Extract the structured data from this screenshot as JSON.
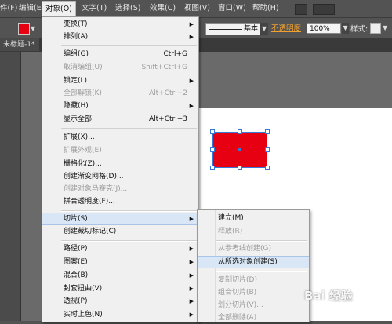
{
  "menubar": {
    "items": [
      {
        "label": "件(F)"
      },
      {
        "label": "编辑(E)"
      },
      {
        "label": "对象(O)"
      },
      {
        "label": "文字(T)"
      },
      {
        "label": "选择(S)"
      },
      {
        "label": "效果(C)"
      },
      {
        "label": "视图(V)"
      },
      {
        "label": "窗口(W)"
      },
      {
        "label": "帮助(H)"
      }
    ]
  },
  "controlbar": {
    "fill_color": "#e60012",
    "stroke_style": "基本",
    "opacity_label": "不透明度",
    "opacity_value": "100%",
    "style_label": "样式:"
  },
  "document": {
    "tab_label": "未标题-1*"
  },
  "canvas": {
    "object_color": "#e60012"
  },
  "object_menu": {
    "items": [
      {
        "label": "变换(T)",
        "shortcut": "",
        "submenu": true,
        "disabled": false
      },
      {
        "label": "排列(A)",
        "shortcut": "",
        "submenu": true,
        "disabled": false
      },
      {
        "label": "编组(G)",
        "shortcut": "Ctrl+G",
        "submenu": false,
        "disabled": false
      },
      {
        "label": "取消编组(U)",
        "shortcut": "Shift+Ctrl+G",
        "submenu": false,
        "disabled": true
      },
      {
        "label": "锁定(L)",
        "shortcut": "",
        "submenu": true,
        "disabled": false
      },
      {
        "label": "全部解锁(K)",
        "shortcut": "Alt+Ctrl+2",
        "submenu": false,
        "disabled": true
      },
      {
        "label": "隐藏(H)",
        "shortcut": "",
        "submenu": true,
        "disabled": false
      },
      {
        "label": "显示全部",
        "shortcut": "Alt+Ctrl+3",
        "submenu": false,
        "disabled": false
      },
      {
        "label": "扩展(X)...",
        "shortcut": "",
        "submenu": false,
        "disabled": false
      },
      {
        "label": "扩展外观(E)",
        "shortcut": "",
        "submenu": false,
        "disabled": true
      },
      {
        "label": "栅格化(Z)...",
        "shortcut": "",
        "submenu": false,
        "disabled": false
      },
      {
        "label": "创建渐变网格(D)...",
        "shortcut": "",
        "submenu": false,
        "disabled": false
      },
      {
        "label": "创建对象马赛克(J)...",
        "shortcut": "",
        "submenu": false,
        "disabled": true
      },
      {
        "label": "拼合透明度(F)...",
        "shortcut": "",
        "submenu": false,
        "disabled": false
      },
      {
        "label": "切片(S)",
        "shortcut": "",
        "submenu": true,
        "disabled": false
      },
      {
        "label": "创建裁切标记(C)",
        "shortcut": "",
        "submenu": false,
        "disabled": false
      },
      {
        "label": "路径(P)",
        "shortcut": "",
        "submenu": true,
        "disabled": false
      },
      {
        "label": "图案(E)",
        "shortcut": "",
        "submenu": true,
        "disabled": false
      },
      {
        "label": "混合(B)",
        "shortcut": "",
        "submenu": true,
        "disabled": false
      },
      {
        "label": "封套扭曲(V)",
        "shortcut": "",
        "submenu": true,
        "disabled": false
      },
      {
        "label": "透视(P)",
        "shortcut": "",
        "submenu": true,
        "disabled": false
      },
      {
        "label": "实时上色(N)",
        "shortcut": "",
        "submenu": true,
        "disabled": false
      }
    ]
  },
  "slice_submenu": {
    "items": [
      {
        "label": "建立(M)",
        "disabled": false
      },
      {
        "label": "释放(R)",
        "disabled": true
      },
      {
        "label": "从参考线创建(G)",
        "disabled": true
      },
      {
        "label": "从所选对象创建(S)",
        "disabled": false
      },
      {
        "label": "复制切片(D)",
        "disabled": true
      },
      {
        "label": "组合切片(B)",
        "disabled": true
      },
      {
        "label": "划分切片(V)...",
        "disabled": true
      },
      {
        "label": "全部删除(A)",
        "disabled": true
      }
    ]
  },
  "watermark": {
    "text": "Bai 经验"
  }
}
